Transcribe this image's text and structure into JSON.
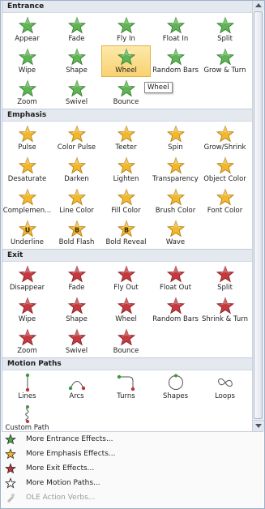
{
  "sections": [
    {
      "title": "Entrance",
      "kind": "entrance",
      "items": [
        {
          "label": "Appear"
        },
        {
          "label": "Fade"
        },
        {
          "label": "Fly In"
        },
        {
          "label": "Float In"
        },
        {
          "label": "Split"
        },
        {
          "label": "Wipe"
        },
        {
          "label": "Shape"
        },
        {
          "label": "Wheel",
          "selected": true
        },
        {
          "label": "Random Bars"
        },
        {
          "label": "Grow & Turn"
        },
        {
          "label": "Zoom"
        },
        {
          "label": "Swivel"
        },
        {
          "label": "Bounce"
        }
      ]
    },
    {
      "title": "Emphasis",
      "kind": "emphasis",
      "items": [
        {
          "label": "Pulse"
        },
        {
          "label": "Color Pulse"
        },
        {
          "label": "Teeter"
        },
        {
          "label": "Spin"
        },
        {
          "label": "Grow/Shrink"
        },
        {
          "label": "Desaturate"
        },
        {
          "label": "Darken"
        },
        {
          "label": "Lighten"
        },
        {
          "label": "Transparency"
        },
        {
          "label": "Object Color"
        },
        {
          "label": "Complemen..."
        },
        {
          "label": "Line Color"
        },
        {
          "label": "Fill Color"
        },
        {
          "label": "Brush Color"
        },
        {
          "label": "Font Color"
        },
        {
          "label": "Underline",
          "letter": "U"
        },
        {
          "label": "Bold Flash",
          "letter": "B"
        },
        {
          "label": "Bold Reveal",
          "letter": "B"
        },
        {
          "label": "Wave"
        }
      ]
    },
    {
      "title": "Exit",
      "kind": "exit",
      "items": [
        {
          "label": "Disappear"
        },
        {
          "label": "Fade"
        },
        {
          "label": "Fly Out"
        },
        {
          "label": "Float Out"
        },
        {
          "label": "Split"
        },
        {
          "label": "Wipe"
        },
        {
          "label": "Shape"
        },
        {
          "label": "Wheel"
        },
        {
          "label": "Random Bars"
        },
        {
          "label": "Shrink & Turn"
        },
        {
          "label": "Zoom"
        },
        {
          "label": "Swivel"
        },
        {
          "label": "Bounce"
        }
      ]
    },
    {
      "title": "Motion Paths",
      "kind": "motion",
      "items": [
        {
          "label": "Lines",
          "path": "lines"
        },
        {
          "label": "Arcs",
          "path": "arcs"
        },
        {
          "label": "Turns",
          "path": "turns"
        },
        {
          "label": "Shapes",
          "path": "shapes"
        },
        {
          "label": "Loops",
          "path": "loops"
        },
        {
          "label": "Custom Path",
          "path": "custom"
        }
      ]
    }
  ],
  "tooltip": "Wheel",
  "menu": [
    {
      "label": "More Entrance Effects...",
      "icon": "green-star-icon"
    },
    {
      "label": "More Emphasis Effects...",
      "icon": "yellow-star-icon"
    },
    {
      "label": "More Exit Effects...",
      "icon": "red-star-icon"
    },
    {
      "label": "More Motion Paths...",
      "icon": "outline-star-icon"
    },
    {
      "label": "OLE Action Verbs...",
      "icon": "ole-icon",
      "disabled": true
    }
  ],
  "colors": {
    "entrance": "#4ea446",
    "emphasis": "#f0b526",
    "exit": "#c0323a",
    "selected": "#f8d272"
  }
}
